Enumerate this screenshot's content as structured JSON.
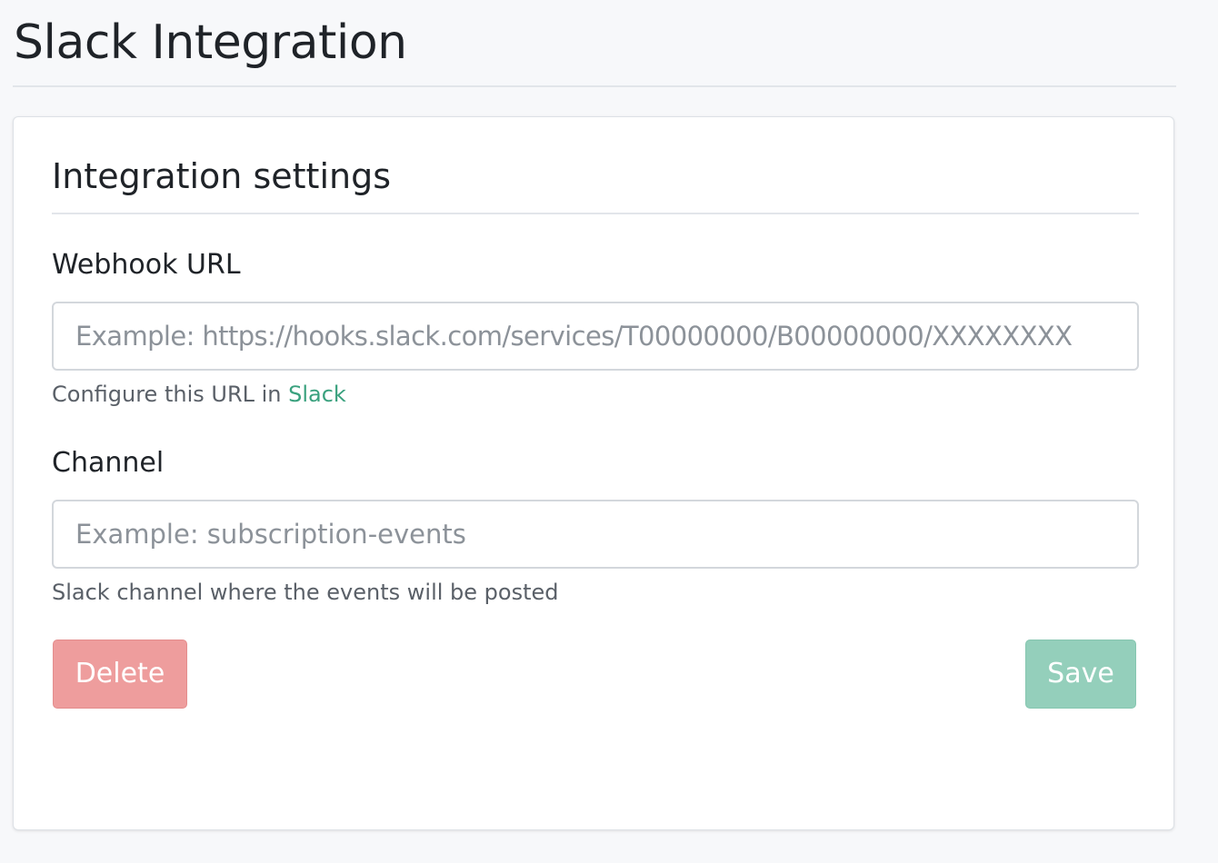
{
  "page": {
    "title": "Slack Integration"
  },
  "settings": {
    "section_title": "Integration settings",
    "webhook": {
      "label": "Webhook URL",
      "value": "",
      "placeholder": "Example: https://hooks.slack.com/services/T00000000/B00000000/XXXXXXXX",
      "help_prefix": "Configure this URL in ",
      "help_link": "Slack"
    },
    "channel": {
      "label": "Channel",
      "value": "",
      "placeholder": "Example: subscription-events",
      "help": "Slack channel where the events will be posted"
    },
    "actions": {
      "delete_label": "Delete",
      "save_label": "Save"
    }
  },
  "colors": {
    "background": "#f7f8fa",
    "link": "#3aa17e",
    "delete_button": "#ee9d9d",
    "save_button": "#94cfbb"
  }
}
